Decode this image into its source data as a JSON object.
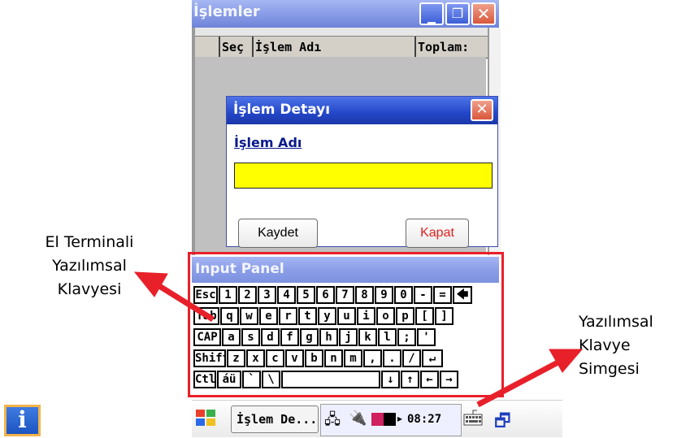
{
  "window": {
    "title": "İşlemler",
    "minimize_icon": "minimize-icon",
    "restore_icon": "restore-icon",
    "close_icon": "close-icon"
  },
  "grid": {
    "columns": [
      "",
      "Seç",
      "İşlem Adı",
      "Toplam:"
    ]
  },
  "dialog": {
    "title": "İşlem Detayı",
    "field_label": "İşlem Adı",
    "input_value": "",
    "save_label": "Kaydet",
    "close_label": "Kapat",
    "close_label_color": "#e02020",
    "input_bg": "#ffff00"
  },
  "input_panel": {
    "title": "Input Panel",
    "rows": [
      [
        "Esc",
        "1",
        "2",
        "3",
        "4",
        "5",
        "6",
        "7",
        "8",
        "9",
        "0",
        "-",
        "=",
        "🡄"
      ],
      [
        "Tab",
        "q",
        "w",
        "e",
        "r",
        "t",
        "y",
        "u",
        "i",
        "o",
        "p",
        "[",
        "]"
      ],
      [
        "CAP",
        "a",
        "s",
        "d",
        "f",
        "g",
        "h",
        "j",
        "k",
        "l",
        ";",
        "'"
      ],
      [
        "Shift",
        "z",
        "x",
        "c",
        "v",
        "b",
        "n",
        "m",
        ",",
        ".",
        "/",
        "↵"
      ],
      [
        "Ctl",
        "áü",
        "`",
        "\\",
        "",
        "↓",
        "↑",
        "←",
        "→"
      ]
    ]
  },
  "taskbar": {
    "start_icon": "windows-flag-icon",
    "task_label": "İşlem De...",
    "clock": "08:27",
    "keyboard_icon": "keyboard-icon",
    "switch_icon": "window-switch-icon"
  },
  "annotations": {
    "left_line1": "El Terminali",
    "left_line2": "Yazılımsal",
    "left_line3": "Klavyesi",
    "right_line1": "Yazılımsal",
    "right_line2": "Klavye",
    "right_line3": "Simgesi",
    "highlight_color": "#e8202a"
  },
  "info_icon": "i"
}
